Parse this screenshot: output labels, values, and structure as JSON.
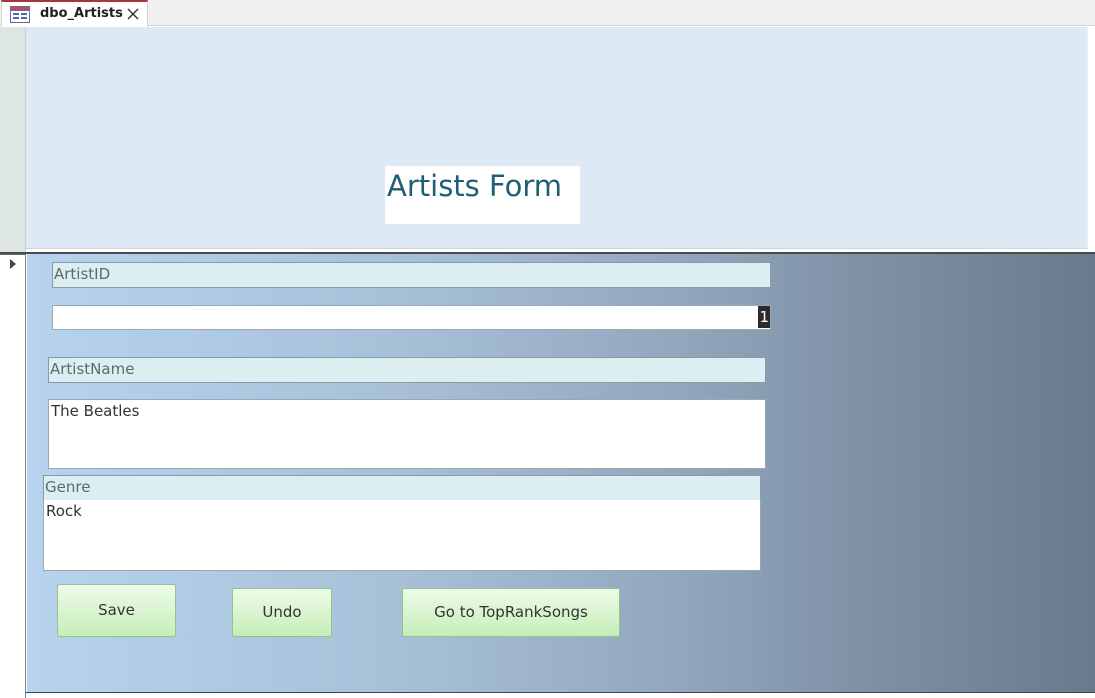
{
  "tab": {
    "icon": "form-icon",
    "label": "dbo_Artists",
    "close_icon": "close-icon"
  },
  "header": {
    "title": "Artists Form"
  },
  "record_selector": {
    "icon": "current-record-arrow-icon"
  },
  "fields": {
    "artist_id": {
      "label": "ArtistID",
      "value": "1"
    },
    "artist_name": {
      "label": "ArtistName",
      "value": "The Beatles"
    },
    "genre": {
      "label": "Genre",
      "value": "Rock"
    }
  },
  "buttons": {
    "save": "Save",
    "undo": "Undo",
    "goto": "Go to TopRankSongs"
  },
  "colors": {
    "title_color": "#1e5f74",
    "header_bg": "#dde9f5",
    "button_green": "#d6f3cc",
    "tab_accent": "#a4373a"
  }
}
